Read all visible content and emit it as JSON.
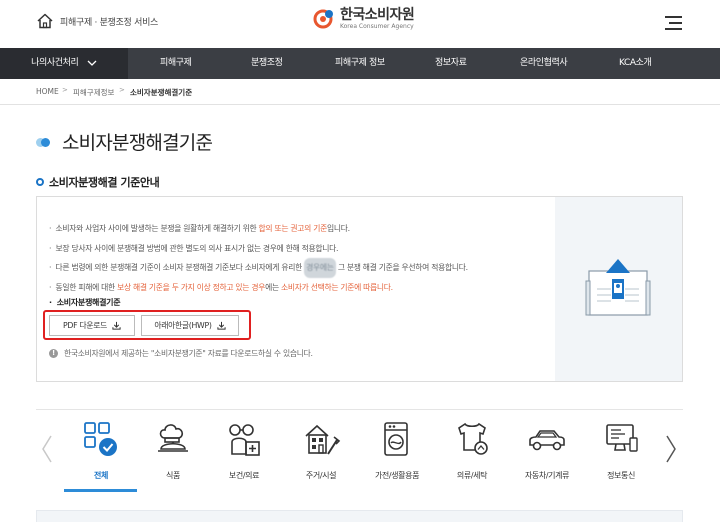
{
  "header": {
    "home_label": "피해구제 · 분쟁조정 서비스",
    "logo_ko": "한국소비자원",
    "logo_en": "Korea Consumer Agency"
  },
  "gnb": {
    "items": [
      "나의사건처리",
      "피해구제",
      "분쟁조정",
      "피해구제 정보",
      "정보자료",
      "온라인협력사",
      "KCA소개"
    ]
  },
  "breadcrumb": [
    "HOME",
    "피해구제정보",
    "소비자분쟁해결기준"
  ],
  "page_title": "소비자분쟁해결기준",
  "section_title": "소비자분쟁해결 기준안내",
  "info": {
    "line1_pre": "소비자와 사업자 사이에 발생하는 분쟁을 원활하게 해결하기 위한 ",
    "line1_em": "합의 또는 권고의 기준",
    "line1_post": "입니다.",
    "line2": "보장 당사자 사이에 분쟁해결 방법에 관한 별도의 의사 표시가 없는 경우에 한해 적용합니다.",
    "line3_pre": "다른 법령에 의한 분쟁해결 기준이 소비자 분쟁해결 기준보다 소비자에게 유리한 ",
    "line3_blur": "경우에는",
    "line3_post": " 그 분쟁 해결 기준을 우선하여 적용합니다.",
    "line4_pre": "동일한 피해에 대한 ",
    "line4_em1": "보상 해결 기준을 두 가지 이상 정하고 있는 경우",
    "line4_mid": "에는 ",
    "line4_em2": "소비자가 선택하는 기준에 따릅니다.",
    "subheading": "소비자분쟁해결기준",
    "pdf_label": "PDF 다운로드",
    "hwp_label": "아래아한글(HWP)",
    "notice": "한국소비자원에서 제공하는 \"소비자분쟁기준\" 자료를 다운로드하실 수 있습니다."
  },
  "categories": [
    {
      "label": "전체",
      "icon": "grid-check-icon"
    },
    {
      "label": "식품",
      "icon": "food-chef-icon"
    },
    {
      "label": "보건/의료",
      "icon": "medical-glasses-icon"
    },
    {
      "label": "주거/시설",
      "icon": "house-tools-icon"
    },
    {
      "label": "가전/생활용품",
      "icon": "washing-machine-icon"
    },
    {
      "label": "의류/세탁",
      "icon": "shirt-hanger-icon"
    },
    {
      "label": "자동차/기계류",
      "icon": "car-icon"
    },
    {
      "label": "정보통신",
      "icon": "monitor-icon"
    }
  ],
  "colors": {
    "gnb_bg": "#3b3e44",
    "accent_blue": "#2d8cd8",
    "emphasis_orange": "#e4623a",
    "highlight_red": "#e02020"
  }
}
